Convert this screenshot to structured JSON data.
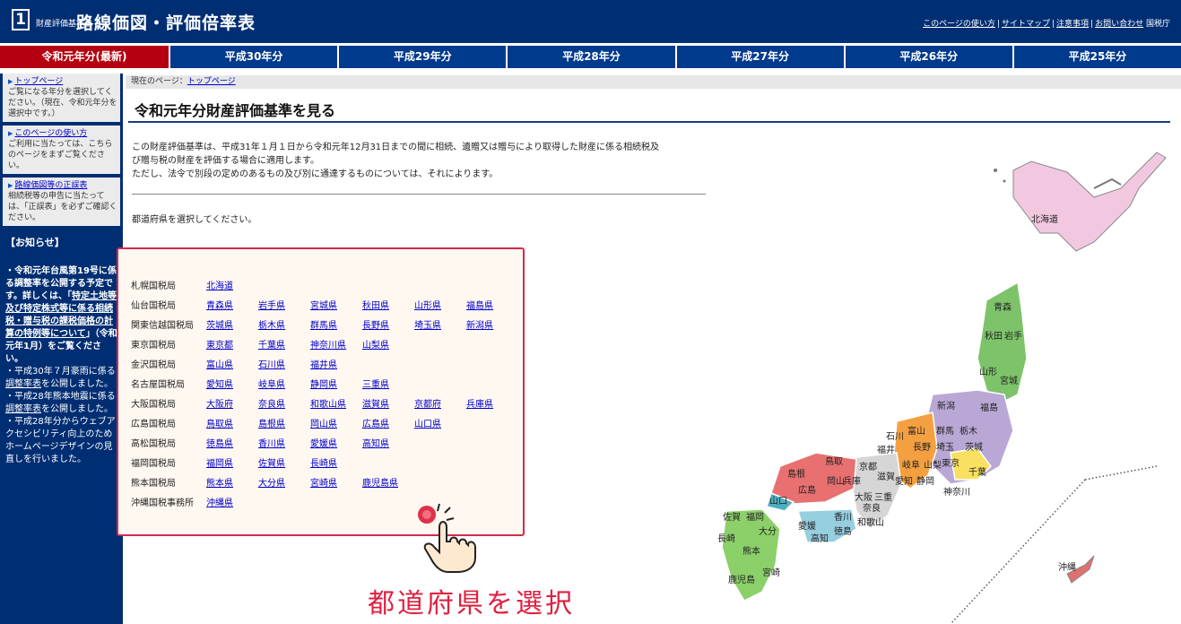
{
  "header": {
    "logo_number": "1",
    "logo_small": "財産評価基準書",
    "title": "路線価図・評価倍率表",
    "links": [
      "このページの使い方",
      "サイトマップ",
      "注意事項",
      "お問い合わせ"
    ],
    "agency": "国税庁"
  },
  "tabs": [
    "令和元年分(最新)",
    "平成30年分",
    "平成29年分",
    "平成28年分",
    "平成27年分",
    "平成26年分",
    "平成25年分"
  ],
  "sidebar": {
    "items": [
      {
        "link": "トップページ",
        "text": "ご覧になる年分を選択してください。（現在、令和元年分を選択中です。）"
      },
      {
        "link": "このページの使い方",
        "text": "ご利用に当たっては、こちらのページをまずご覧ください。"
      },
      {
        "link": "路線価図等の正誤表",
        "text": "相続税等の申告に当たっては、「正誤表」を必ずご確認ください。"
      }
    ],
    "notice_title": "【お知らせ】",
    "notice_1_pre": "・令和元年台風第19号に係る調整率を公開する予定です。詳しくは、「",
    "notice_1_link": "特定土地等及び特定株式等に係る相続税・贈与税の課税価格の計算の特例等について",
    "notice_1_post": "」（令和元年1月）をご覧ください。",
    "notice_2_pre": "・平成30年７月豪雨に係る",
    "notice_2_link": "調整率表",
    "notice_2_post": "を公開しました。",
    "notice_3_pre": "・平成28年熊本地震に係る",
    "notice_3_link": "調整率表",
    "notice_3_post": "を公開しました。",
    "notice_4": "・平成28年分からウェブアクセシビリティ向上のためホームページデザインの見直しを行いました。"
  },
  "breadcrumb": {
    "prefix": "現在のページ：",
    "link": "トップページ"
  },
  "page_title": "令和元年分財産評価基準を見る",
  "description": {
    "line1": "この財産評価基準は、平成31年１月１日から令和元年12月31日までの間に相続、遺贈又は贈与により取得した財産に係る相続税及",
    "line2": "び贈与税の財産を評価する場合に適用します。",
    "line3": "ただし、法令で別段の定めのあるもの及び別に通達するものについては、それによります。"
  },
  "select_message": "都道府県を選択してください。",
  "bureaus": [
    {
      "name": "札幌国税局",
      "prefs": [
        "北海道"
      ]
    },
    {
      "name": "仙台国税局",
      "prefs": [
        "青森県",
        "岩手県",
        "宮城県",
        "秋田県",
        "山形県",
        "福島県"
      ]
    },
    {
      "name": "関東信越国税局",
      "prefs": [
        "茨城県",
        "栃木県",
        "群馬県",
        "長野県",
        "埼玉県",
        "新潟県"
      ]
    },
    {
      "name": "東京国税局",
      "prefs": [
        "東京都",
        "千葉県",
        "神奈川県",
        "山梨県"
      ]
    },
    {
      "name": "金沢国税局",
      "prefs": [
        "富山県",
        "石川県",
        "福井県"
      ]
    },
    {
      "name": "名古屋国税局",
      "prefs": [
        "愛知県",
        "岐阜県",
        "静岡県",
        "三重県"
      ]
    },
    {
      "name": "大阪国税局",
      "prefs": [
        "大阪府",
        "奈良県",
        "和歌山県",
        "滋賀県",
        "京都府",
        "兵庫県"
      ]
    },
    {
      "name": "広島国税局",
      "prefs": [
        "鳥取県",
        "島根県",
        "岡山県",
        "広島県",
        "山口県"
      ]
    },
    {
      "name": "高松国税局",
      "prefs": [
        "徳島県",
        "香川県",
        "愛媛県",
        "高知県"
      ]
    },
    {
      "name": "福岡国税局",
      "prefs": [
        "福岡県",
        "佐賀県",
        "長崎県"
      ]
    },
    {
      "name": "熊本国税局",
      "prefs": [
        "熊本県",
        "大分県",
        "宮崎県",
        "鹿児島県"
      ]
    },
    {
      "name": "沖縄国税事務所",
      "prefs": [
        "沖縄県"
      ]
    }
  ],
  "callout": "都道府県を選択",
  "map_labels": {
    "hokkaido": "北海道",
    "aomori": "青森",
    "akita": "秋田",
    "iwate": "岩手",
    "yamagata": "山形",
    "miyagi": "宮城",
    "niigata": "新潟",
    "fukushima": "福島",
    "ishikawa": "石川",
    "toyama": "富山",
    "gunma": "群馬",
    "tochigi": "栃木",
    "fukui": "福井",
    "nagano": "長野",
    "saitama": "埼玉",
    "ibaraki": "茨城",
    "gifu": "岐阜",
    "yamanashi": "山梨",
    "tokyo": "東京",
    "chiba": "千葉",
    "kyoto": "京都",
    "shiga": "滋賀",
    "aichi": "愛知",
    "shizuoka": "静岡",
    "kanagawa": "神奈川",
    "shimane": "島根",
    "tottori": "鳥取",
    "okayama": "岡山",
    "hyogo": "兵庫",
    "osaka": "大阪",
    "mie": "三重",
    "hiroshima": "広島",
    "yamaguchi": "山口",
    "kagawa": "香川",
    "nara": "奈良",
    "saga": "佐賀",
    "fukuoka": "福岡",
    "ehime": "愛媛",
    "tokushima": "徳島",
    "wakayama": "和歌山",
    "nagasaki": "長崎",
    "oita": "大分",
    "kochi": "高知",
    "kumamoto": "熊本",
    "miyazaki": "宮崎",
    "kagoshima": "鹿児島",
    "okinawa": "沖縄"
  }
}
